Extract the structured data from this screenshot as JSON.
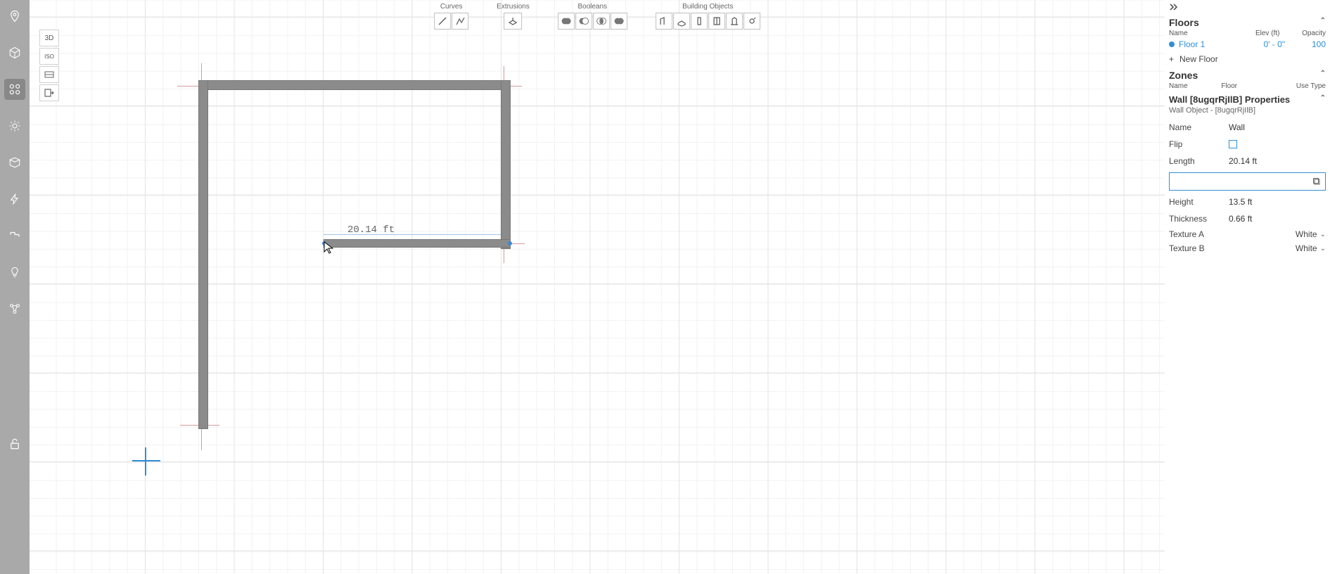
{
  "left_rail": {
    "icons": [
      {
        "name": "pin-icon"
      },
      {
        "name": "cube-icon"
      },
      {
        "name": "modules-icon"
      },
      {
        "name": "sun-icon"
      },
      {
        "name": "box-icon"
      },
      {
        "name": "bolt-icon"
      },
      {
        "name": "pipe-icon"
      },
      {
        "name": "bulb-icon"
      },
      {
        "name": "graph-icon"
      }
    ],
    "bottom_icon": {
      "name": "lock-open-icon"
    }
  },
  "view_stack": {
    "items": [
      "3D",
      "ISO",
      "▭",
      "⇥"
    ]
  },
  "top_tools": {
    "groups": [
      {
        "label": "Curves",
        "count": 2
      },
      {
        "label": "Extrusions",
        "count": 1
      },
      {
        "label": "Booleans",
        "count": 4
      },
      {
        "label": "Building Objects",
        "count": 6
      }
    ]
  },
  "canvas": {
    "dimension_label": "20.14 ft"
  },
  "right": {
    "floors": {
      "title": "Floors",
      "headers": {
        "name": "Name",
        "elev": "Elev (ft)",
        "opacity": "Opacity"
      },
      "items": [
        {
          "name": "Floor 1",
          "elev": "0' - 0\"",
          "opacity": "100"
        }
      ],
      "new_label": "New Floor"
    },
    "zones": {
      "title": "Zones",
      "headers": {
        "name": "Name",
        "floor": "Floor",
        "use": "Use Type"
      }
    },
    "props": {
      "title": "Wall [8ugqrRjIlB] Properties",
      "subtitle": "Wall Object - [8ugqrRjIlB]",
      "rows": {
        "name_label": "Name",
        "name_value": "Wall",
        "flip_label": "Flip",
        "length_label": "Length",
        "length_value": "20.14 ft",
        "height_label": "Height",
        "height_value": "13.5 ft",
        "thickness_label": "Thickness",
        "thickness_value": "0.66 ft",
        "texA_label": "Texture A",
        "texA_value": "White",
        "texB_label": "Texture B",
        "texB_value": "White"
      },
      "input_value": ""
    }
  }
}
